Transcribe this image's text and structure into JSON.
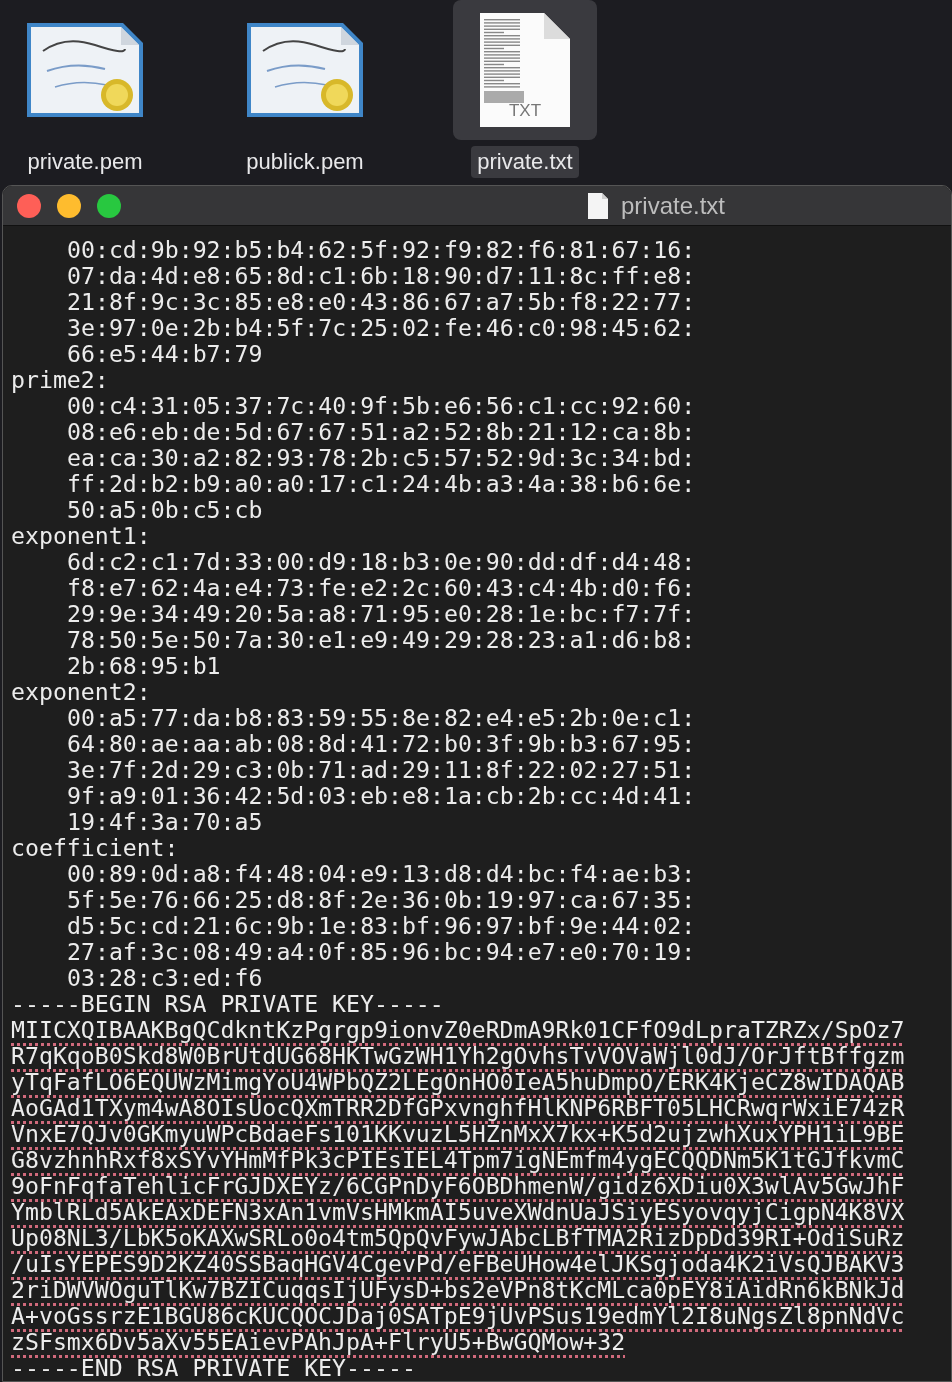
{
  "desktop_icons": [
    {
      "label": "private.pem",
      "kind": "certificate",
      "selected": false
    },
    {
      "label": "publick.pem",
      "kind": "certificate",
      "selected": false
    },
    {
      "label": "private.txt",
      "kind": "text",
      "badge": "TXT",
      "selected": true
    }
  ],
  "window": {
    "title": "private.txt",
    "sections": [
      {
        "values": [
          "00:cd:9b:92:b5:b4:62:5f:92:f9:82:f6:81:67:16:",
          "07:da:4d:e8:65:8d:c1:6b:18:90:d7:11:8c:ff:e8:",
          "21:8f:9c:3c:85:e8:e0:43:86:67:a7:5b:f8:22:77:",
          "3e:97:0e:2b:b4:5f:7c:25:02:fe:46:c0:98:45:62:",
          "66:e5:44:b7:79"
        ]
      },
      {
        "label": "prime2:",
        "values": [
          "00:c4:31:05:37:7c:40:9f:5b:e6:56:c1:cc:92:60:",
          "08:e6:eb:de:5d:67:67:51:a2:52:8b:21:12:ca:8b:",
          "ea:ca:30:a2:82:93:78:2b:c5:57:52:9d:3c:34:bd:",
          "ff:2d:b2:b9:a0:a0:17:c1:24:4b:a3:4a:38:b6:6e:",
          "50:a5:0b:c5:cb"
        ]
      },
      {
        "label": "exponent1:",
        "values": [
          "6d:c2:c1:7d:33:00:d9:18:b3:0e:90:dd:df:d4:48:",
          "f8:e7:62:4a:e4:73:fe:e2:2c:60:43:c4:4b:d0:f6:",
          "29:9e:34:49:20:5a:a8:71:95:e0:28:1e:bc:f7:7f:",
          "78:50:5e:50:7a:30:e1:e9:49:29:28:23:a1:d6:b8:",
          "2b:68:95:b1"
        ]
      },
      {
        "label": "exponent2:",
        "values": [
          "00:a5:77:da:b8:83:59:55:8e:82:e4:e5:2b:0e:c1:",
          "64:80:ae:aa:ab:08:8d:41:72:b0:3f:9b:b3:67:95:",
          "3e:7f:2d:29:c3:0b:71:ad:29:11:8f:22:02:27:51:",
          "9f:a9:01:36:42:5d:03:eb:e8:1a:cb:2b:cc:4d:41:",
          "19:4f:3a:70:a5"
        ]
      },
      {
        "label": "coefficient:",
        "values": [
          "00:89:0d:a8:f4:48:04:e9:13:d8:d4:bc:f4:ae:b3:",
          "5f:5e:76:66:25:d8:8f:2e:36:0b:19:97:ca:67:35:",
          "d5:5c:cd:21:6c:9b:1e:83:bf:96:97:bf:9e:44:02:",
          "27:af:3c:08:49:a4:0f:85:96:bc:94:e7:e0:70:19:",
          "03:28:c3:ed:f6"
        ]
      }
    ],
    "pem": {
      "begin": "-----BEGIN RSA PRIVATE KEY-----",
      "lines": [
        "MIICXQIBAAKBgQCdkntKzPgrgp9ionvZ0eRDmA9Rk01CFfO9dLpraTZRZx/SpOz7",
        "R7qKqoB0Skd8W0BrUtdUG68HKTwGzWH1Yh2gOvhsTvVOVaWjl0dJ/OrJftBffgzm",
        "yTqFafLO6EQUWzMimgYoU4WPbQZ2LEgOnHO0IeA5huDmpO/ERK4KjeCZ8wIDAQAB",
        "AoGAd1TXym4wA8OIsUocQXmTRR2DfGPxvnghfHlKNP6RBFT05LHCRwqrWxiE74zR",
        "VnxE7QJv0GKmyuWPcBdaeFs101KKvuzL5HZnMxX7kx+K5d2ujzwhXuxYPH1iL9BE",
        "G8vzhnhRxf8xSYvYHmMfPk3cPIEsIEL4Tpm7igNEmfm4ygECQQDNm5K1tGJfkvmC",
        "9oFnFqfaTehlicFrGJDXEYz/6CGPnDyF6OBDhmenW/gidz6XDiu0X3wlAv5GwJhF",
        "YmblRLd5AkEAxDEFN3xAn1vmVsHMkmAI5uveXWdnUaJSiyESyovqyjCigpN4K8VX",
        "Up08NL3/LbK5oKAXwSRLo0o4tm5QpQvFywJAbcLBfTMA2RizDpDd39RI+OdiSuRz",
        "/uIsYEPES9D2KZ40SSBaqHGV4CgevPd/eFBeUHow4elJKSgjoda4K2iVsQJBAKV3",
        "2riDWVWOguTlKw7BZICuqqsIjUFysD+bs2eVPn8tKcMLca0pEY8iAidRn6kBNkJd",
        "A+voGssrzE1BGU86cKUCQOCJDaj0SATpE9jUvPSus19edmYl2I8uNgsZl8pnNdVc",
        "zSFsmx6Dv5aXv55EAievPAhJpA+FlryU5+BwGQMow+32"
      ],
      "end": "-----END RSA PRIVATE KEY-----"
    }
  }
}
